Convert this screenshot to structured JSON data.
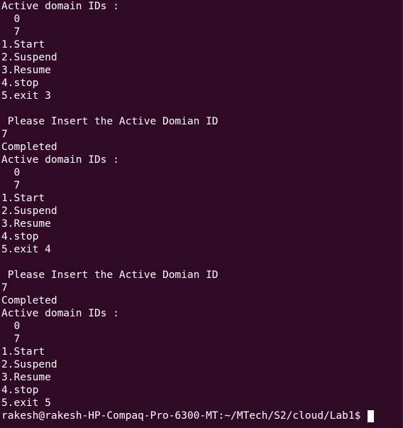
{
  "terminal": {
    "lines": [
      "Active domain IDs :",
      "  0",
      "  7",
      "1.Start",
      "2.Suspend",
      "3.Resume",
      "4.stop",
      "5.exit 3",
      "",
      " Please Insert the Active Domian ID",
      "7",
      "Completed",
      "Active domain IDs :",
      "  0",
      "  7",
      "1.Start",
      "2.Suspend",
      "3.Resume",
      "4.stop",
      "5.exit 4",
      "",
      " Please Insert the Active Domian ID",
      "7",
      "Completed",
      "Active domain IDs :",
      "  0",
      "  7",
      "1.Start",
      "2.Suspend",
      "3.Resume",
      "4.stop",
      "5.exit 5"
    ],
    "prompt": "rakesh@rakesh-HP-Compaq-Pro-6300-MT:~/MTech/S2/cloud/Lab1$ "
  },
  "colors": {
    "background": "#300a24",
    "foreground": "#ffffff"
  }
}
